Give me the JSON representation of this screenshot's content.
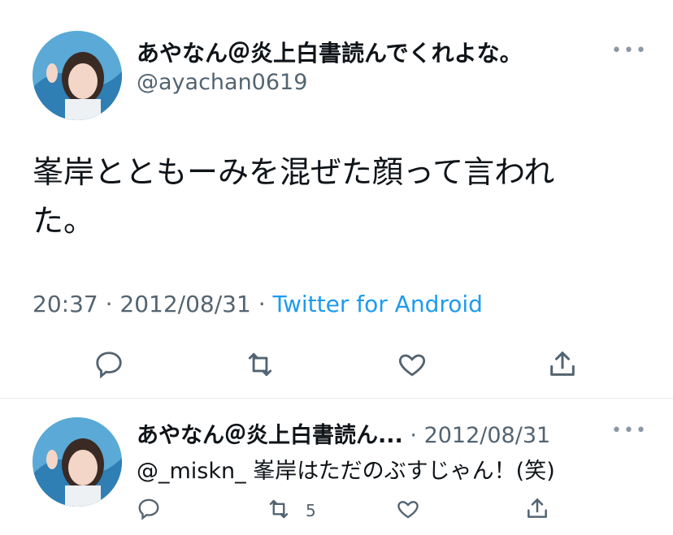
{
  "main_tweet": {
    "display_name": "あやなん＠炎上白書読んでくれよな。",
    "handle": "@ayachan0619",
    "text_line1": "峯岸とともーみを混ぜた顔って言われ",
    "text_line2": "た。",
    "time": "20:37",
    "dot1": "·",
    "date": "2012/08/31",
    "dot2": "·",
    "source": "Twitter for Android",
    "more": "•••",
    "actions": [
      "reply-icon",
      "retweet-icon",
      "like-icon",
      "share-icon"
    ]
  },
  "reply_tweet": {
    "display_name": "あやなん＠炎上白書読ん...",
    "dot": "·",
    "date": "2012/08/31",
    "mention": "@_miskn_",
    "text": " 峯岸はただのぶすじゃん！(笑)",
    "more": "•••",
    "retweet_count": "5"
  },
  "colors": {
    "link": "#1d9bf0",
    "secondary_text": "#536471",
    "divider": "#e6ecf0"
  }
}
